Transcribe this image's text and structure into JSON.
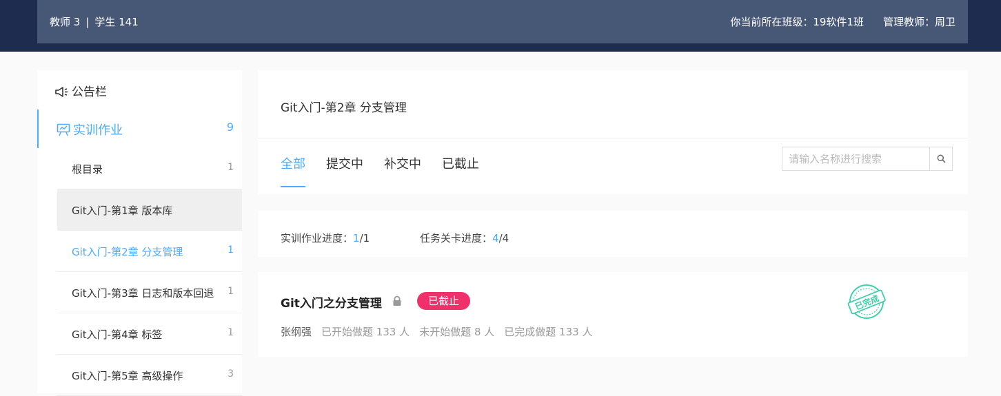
{
  "header": {
    "teachers": "教师 3",
    "separator": "|",
    "students": "学生 141",
    "class_info": "你当前所在班级：19软件1班",
    "admin_teacher": "管理教师：周卫"
  },
  "sidebar": {
    "notice": "公告栏",
    "category": {
      "label": "实训作业",
      "count": "9"
    },
    "items": [
      {
        "label": "根目录",
        "count": "1"
      },
      {
        "label": "Git入门-第1章 版本库",
        "count": ""
      },
      {
        "label": "Git入门-第2章 分支管理",
        "count": "1"
      },
      {
        "label": "Git入门-第3章 日志和版本回退",
        "count": "1"
      },
      {
        "label": "Git入门-第4章 标签",
        "count": "1"
      },
      {
        "label": "Git入门-第5章 高级操作",
        "count": "3"
      }
    ]
  },
  "main": {
    "title": "Git入门-第2章 分支管理",
    "tabs": [
      "全部",
      "提交中",
      "补交中",
      "已截止"
    ],
    "search": {
      "placeholder": "请输入名称进行搜索"
    },
    "progress": {
      "homework_label": "实训作业进度：",
      "homework_done": "1",
      "homework_total": "/1",
      "task_label": "任务关卡进度：",
      "task_done": "4",
      "task_total": "/4"
    },
    "task": {
      "title": "Git入门之分支管理",
      "status": "已截止",
      "stamp_text": "已完成",
      "author": "张纲强",
      "started": "已开始做题 133 人",
      "not_started": "未开始做题 8 人",
      "completed": "已完成做题 133 人"
    }
  },
  "colors": {
    "accent": "#4cacff",
    "header_dark": "#1e2c4f",
    "header_bar": "#475877",
    "badge": "#f0306b",
    "stamp": "#3fcfa8"
  }
}
